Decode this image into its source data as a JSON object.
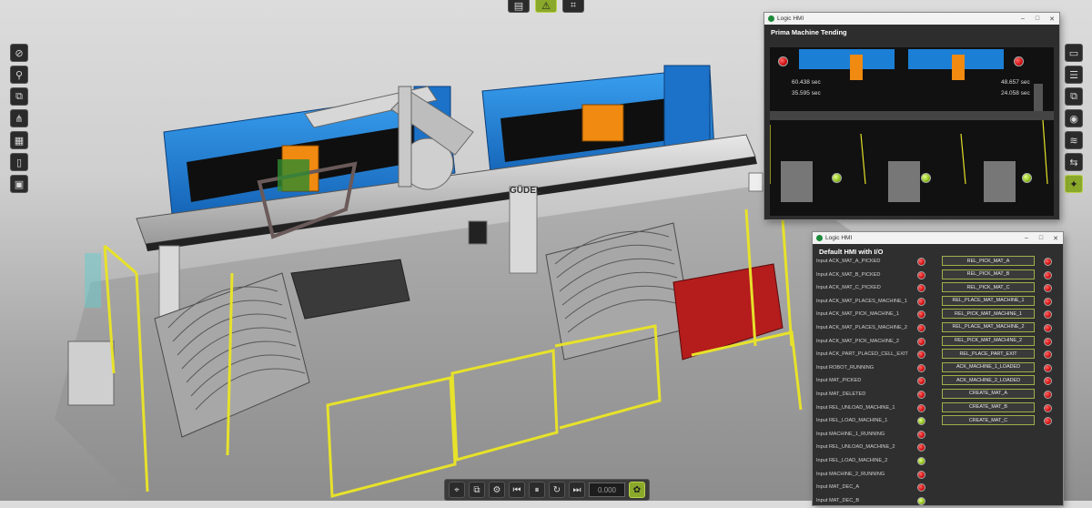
{
  "colors": {
    "accent": "#8aa82a",
    "lamp_red": "#d01010",
    "lamp_green": "#8fc020",
    "machine_blue": "#1c7fd6",
    "fence_yellow": "#e7e22a",
    "robot_orange": "#f08a10"
  },
  "top_toolbar": {
    "icons": [
      "layout-icon",
      "warning-icon",
      "schematic-icon"
    ]
  },
  "left_toolbar": {
    "icons": [
      "select-icon",
      "measure-icon",
      "copy-icon",
      "network-icon",
      "calculator-icon",
      "document-icon",
      "save-icon"
    ]
  },
  "right_toolbar": {
    "icons": [
      "panel-icon",
      "list-icon",
      "copy-icon",
      "sensor-icon",
      "signal-icon",
      "connect-icon",
      "run-icon"
    ]
  },
  "bottom_toolbar": {
    "icons": [
      "snap-icon",
      "frame-icon",
      "robot-icon",
      "rewind-icon",
      "pause-icon",
      "loop-icon",
      "step-forward-icon"
    ],
    "speed_value": "0.000",
    "settings_icon": "settings-icon"
  },
  "scene": {
    "brand_label": "GÜDEL"
  },
  "prima": {
    "app_title": "Logic HMI",
    "header": "Prima Machine Tending",
    "timers": [
      "60.438 sec",
      "35.595 sec",
      "48.657 sec",
      "24.058 sec"
    ],
    "lamps_top": [
      "red",
      "red"
    ],
    "lamps_bottom": [
      "green",
      "green",
      "green"
    ]
  },
  "hmi": {
    "app_title": "Logic HMI",
    "header": "Default HMI with I/O",
    "rows": [
      {
        "label": "Input  ACK_MAT_A_PICKED",
        "lamp": "red",
        "button": "REL_PICK_MAT_A",
        "lamp2": "red"
      },
      {
        "label": "Input  ACK_MAT_B_PICKED",
        "lamp": "red",
        "button": "REL_PICK_MAT_B",
        "lamp2": "red"
      },
      {
        "label": "Input  ACK_MAT_C_PICKED",
        "lamp": "red",
        "button": "REL_PICK_MAT_C",
        "lamp2": "red"
      },
      {
        "label": "Input  ACK_MAT_PLACES_MACHINE_1",
        "lamp": "red",
        "button": "REL_PLACE_MAT_MACHINE_1",
        "lamp2": "red"
      },
      {
        "label": "Input  ACK_MAT_PICK_MACHINE_1",
        "lamp": "red",
        "button": "REL_PICK_MAT_MACHINE_1",
        "lamp2": "red"
      },
      {
        "label": "Input  ACK_MAT_PLACES_MACHINE_2",
        "lamp": "red",
        "button": "REL_PLACE_MAT_MACHINE_2",
        "lamp2": "red"
      },
      {
        "label": "Input  ACK_MAT_PICK_MACHINE_2",
        "lamp": "red",
        "button": "REL_PICK_MAT_MACHINE_2",
        "lamp2": "red"
      },
      {
        "label": "Input  ACK_PART_PLACED_CELL_EXIT",
        "lamp": "red",
        "button": "REL_PLACE_PART_EXIT",
        "lamp2": "red"
      },
      {
        "label": "Input  ROBOT_RUNNING",
        "lamp": "red",
        "button": "ACK_MACHINE_1_LOADED",
        "lamp2": "red"
      },
      {
        "label": "Input  MAT_PICKED",
        "lamp": "red",
        "button": "ACK_MACHINE_2_LOADED",
        "lamp2": "red"
      },
      {
        "label": "Input  MAT_DELETED",
        "lamp": "red",
        "button": "CREATE_MAT_A",
        "lamp2": "red"
      },
      {
        "label": "Input  REL_UNLOAD_MACHINE_1",
        "lamp": "red",
        "button": "CREATE_MAT_B",
        "lamp2": "red"
      },
      {
        "label": "Input  REL_LOAD_MACHINE_1",
        "lamp": "green",
        "button": "CREATE_MAT_C",
        "lamp2": "red"
      },
      {
        "label": "Input  MACHINE_1_RUNNING",
        "lamp": "red",
        "button": "",
        "lamp2": ""
      },
      {
        "label": "Input  REL_UNLOAD_MACHINE_2",
        "lamp": "red",
        "button": "",
        "lamp2": ""
      },
      {
        "label": "Input  REL_LOAD_MACHINE_2",
        "lamp": "green",
        "button": "",
        "lamp2": ""
      },
      {
        "label": "Input  MACHINE_2_RUNNING",
        "lamp": "red",
        "button": "",
        "lamp2": ""
      },
      {
        "label": "Input  MAT_DEC_A",
        "lamp": "red",
        "button": "",
        "lamp2": ""
      },
      {
        "label": "Input  MAT_DEC_B",
        "lamp": "green",
        "button": "",
        "lamp2": ""
      }
    ]
  }
}
